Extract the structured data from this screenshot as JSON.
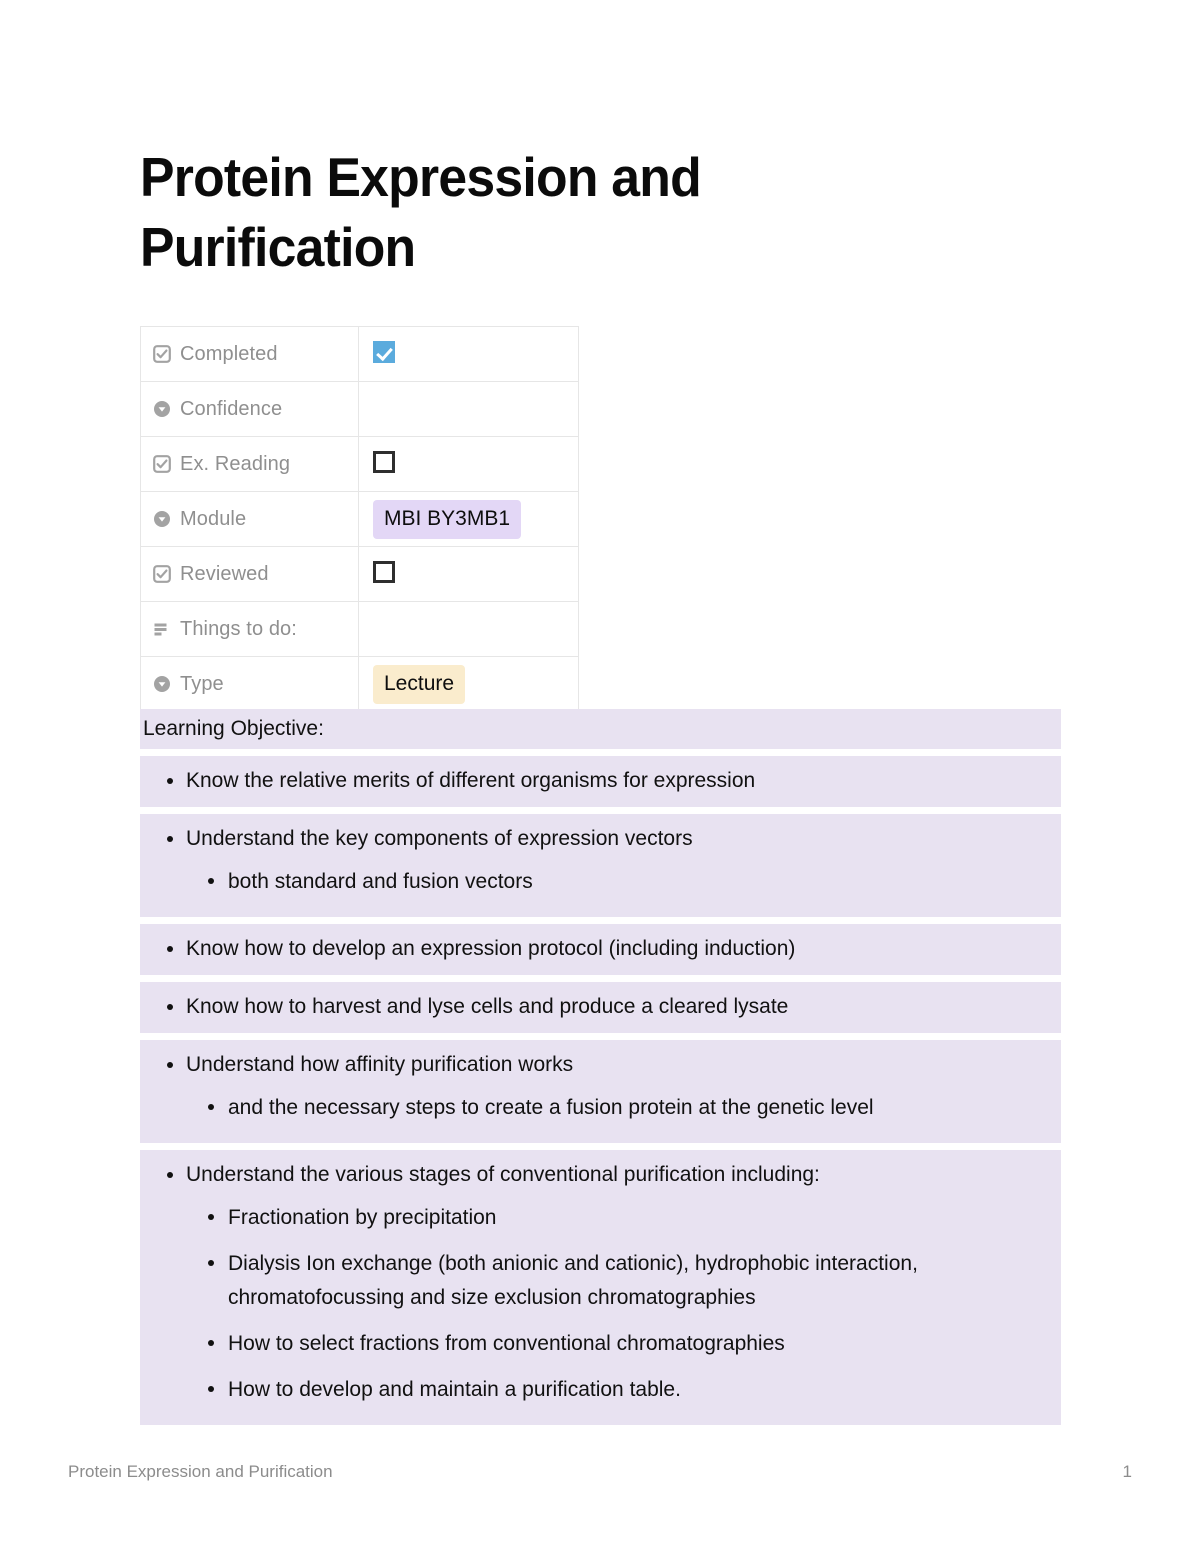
{
  "document": {
    "title": "Protein Expression and Purification"
  },
  "properties": {
    "rows": [
      {
        "icon": "checkbox-icon",
        "label": "Completed",
        "value_type": "checkbox",
        "checked": true,
        "value": ""
      },
      {
        "icon": "select-icon",
        "label": "Confidence",
        "value_type": "empty",
        "checked": false,
        "value": ""
      },
      {
        "icon": "checkbox-icon",
        "label": "Ex. Reading",
        "value_type": "checkbox",
        "checked": false,
        "value": ""
      },
      {
        "icon": "select-icon",
        "label": "Module",
        "value_type": "tag",
        "checked": false,
        "value": "MBI BY3MB1"
      },
      {
        "icon": "checkbox-icon",
        "label": "Reviewed",
        "value_type": "checkbox",
        "checked": false,
        "value": ""
      },
      {
        "icon": "text-icon",
        "label": "Things to do:",
        "value_type": "empty",
        "checked": false,
        "value": ""
      },
      {
        "icon": "select-icon",
        "label": "Type",
        "value_type": "tag",
        "checked": false,
        "value": "Lecture"
      }
    ]
  },
  "objectives": {
    "heading": "Learning Objective:",
    "items": [
      {
        "text": "Know the relative merits of different organisms for expression",
        "children": []
      },
      {
        "text": "Understand the key components of expression vectors",
        "children": [
          "both standard and fusion vectors"
        ]
      },
      {
        "text": "Know how to develop an expression protocol (including induction)",
        "children": []
      },
      {
        "text": "Know how to harvest and lyse cells and produce a cleared lysate",
        "children": []
      },
      {
        "text": "Understand how affinity purification works",
        "children": [
          "and the necessary steps to create a fusion protein at the genetic level"
        ]
      },
      {
        "text": "Understand the various stages of conventional purification including:",
        "children": [
          "Fractionation by precipitation",
          "Dialysis Ion exchange (both anionic and cationic), hydrophobic interaction, chromatofocussing and size exclusion chromatographies",
          "How to select fractions from conventional chromatographies",
          "How to develop and maintain a purification table."
        ]
      }
    ]
  },
  "footer": {
    "left": "Protein Expression and Purification",
    "page_number": "1"
  },
  "colors": {
    "highlight": "#e8e2f1",
    "checkbox_checked": "#5babdd",
    "tag_module": "#e3d7f6",
    "tag_type": "#faeccd",
    "key_label": "#8f8f8f",
    "footer_text": "#8c8c8c"
  }
}
